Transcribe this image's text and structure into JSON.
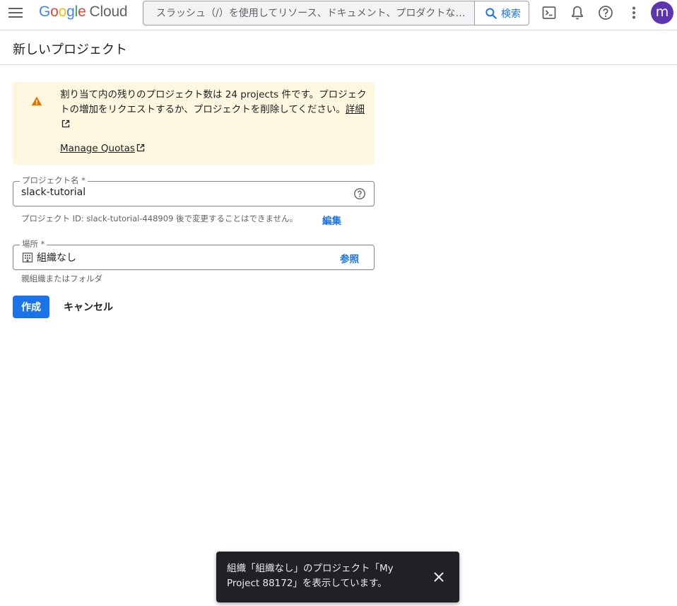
{
  "app": {
    "logo_letters": [
      "G",
      "o",
      "o",
      "g",
      "l",
      "e"
    ],
    "logo_product": "Cloud"
  },
  "search": {
    "placeholder": "スラッシュ（/）を使用してリソース、ドキュメント、プロダクトなど...",
    "button_label": "検索"
  },
  "topbar_icons": [
    "menu-icon",
    "cloud-shell-icon",
    "bell-icon",
    "help-icon",
    "more-vert-icon"
  ],
  "user": {
    "avatar_initial": "m",
    "avatar_color": "#5e35b1"
  },
  "page": {
    "title": "新しいプロジェクト"
  },
  "warning": {
    "text": "割り当て内の残りのプロジェクト数は 24 projects 件です。プロジェクトの増加をリクエストするか、プロジェクトを削除してください。",
    "details_link": "詳細",
    "quota_link": "Manage Quotas",
    "background": "#fef7e0",
    "icon_color": "#e37400"
  },
  "project_name": {
    "label": "プロジェクト名 *",
    "value": "slack-tutorial",
    "id_hint": "プロジェクト ID: slack-tutorial-448909 後で変更することはできません。",
    "edit_label": "編集"
  },
  "location": {
    "label": "場所 *",
    "value": "組織なし",
    "browse_label": "参照",
    "hint": "親組織またはフォルダ"
  },
  "actions": {
    "create_label": "作成",
    "cancel_label": "キャンセル",
    "primary_color": "#1a73e8"
  },
  "snackbar": {
    "message": "組織「組織なし」のプロジェクト「My Project 88172」を表示しています。"
  }
}
